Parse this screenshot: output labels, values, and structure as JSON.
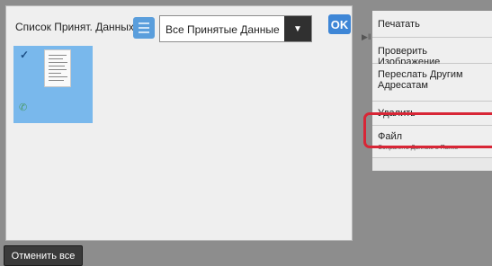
{
  "list_header": {
    "label": "Список Принят. Данных",
    "view_toggle_icon": "list-icon",
    "filter_select": {
      "selected": "Все Принятые Данные",
      "arrow_icon": "triangle-down-icon"
    },
    "ok_label": "OK"
  },
  "received_items": [
    {
      "thumbnail": "document-page-icon",
      "selected": true,
      "status_icon": "fax-icon"
    }
  ],
  "side_menu": {
    "collapse_icon": "play-pause-icon",
    "items": [
      {
        "label": "Печатать"
      },
      {
        "label": "Проверить Изображение"
      },
      {
        "label": "Переслать Другим Адресатам"
      },
      {
        "label": "Удалить"
      },
      {
        "label": "Файл",
        "sublabel": "Сохранить Данные в Папке",
        "highlighted": true
      }
    ]
  },
  "footer": {
    "cancel_all_label": "Отменить все"
  },
  "colors": {
    "accent": "#3e86d6",
    "selected_thumb": "#79b8ec",
    "highlight": "#d82636",
    "background": "#8d8d8d"
  }
}
